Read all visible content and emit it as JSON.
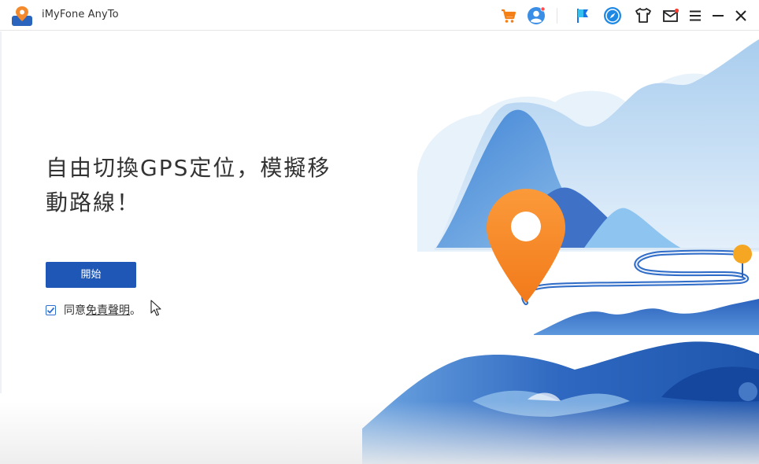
{
  "app": {
    "title": "iMyFone AnyTo"
  },
  "toolbar": {
    "icons": [
      "cart-icon",
      "account-icon",
      "flag-icon",
      "compass-icon",
      "shirt-icon",
      "mail-icon",
      "menu-icon",
      "minimize-icon",
      "close-icon"
    ]
  },
  "main": {
    "headline_line1": "自由切換GPS定位，模擬移",
    "headline_line2": "動路線！",
    "start_label": "開始",
    "agree_prefix": "同意",
    "agree_link": "免責聲明",
    "agree_suffix": "。",
    "agree_checked": true
  },
  "colors": {
    "accent": "#1e57b5",
    "pin": "#f58a2c",
    "mountain_light": "#b9d7f1",
    "mountain_mid": "#5f9fdc",
    "mountain_dark": "#2a64bd"
  }
}
